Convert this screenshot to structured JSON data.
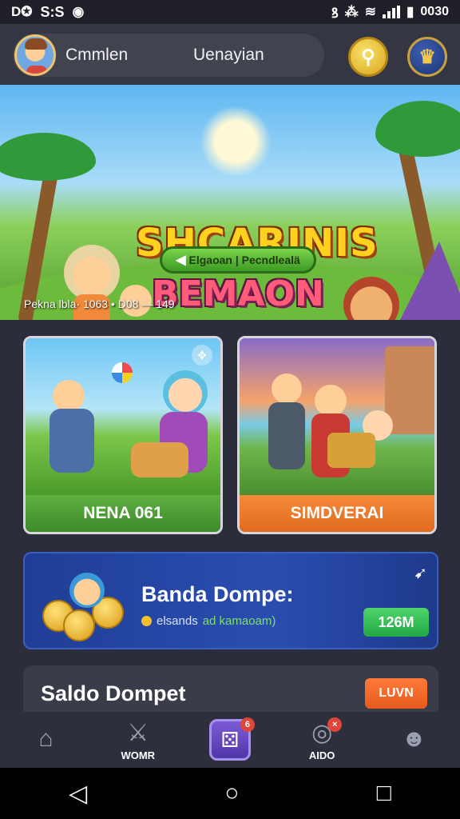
{
  "status_bar": {
    "left_text": "S:S",
    "time": "0030"
  },
  "header": {
    "profile_name": "Cmmlen",
    "profile_sub": "Uenayian"
  },
  "banner": {
    "title_line1": "SHCARINIS",
    "title_line2": "BEMAON",
    "cta_label": "Elgaoan | Pecndlealä",
    "caption": "Pekna lbla· 1063 • D08 — 149"
  },
  "games": [
    {
      "label": "NENA 061"
    },
    {
      "label": "SIMDVERAI"
    }
  ],
  "wallet": {
    "title": "Banda Dompe:",
    "sub_text": "elsands",
    "sub_highlight": "ad kamaoam)",
    "button_label": "126M"
  },
  "saldo": {
    "title": "Saldo Dompet",
    "button_label": "LUVN"
  },
  "bottom_nav": [
    {
      "label": "",
      "icon": "home-icon"
    },
    {
      "label": "WOMR",
      "icon": "sword-icon"
    },
    {
      "label": "",
      "icon": "dice-icon",
      "badge": "6"
    },
    {
      "label": "AIDO",
      "icon": "target-icon",
      "badge": "×"
    },
    {
      "label": "",
      "icon": "profile-icon"
    }
  ],
  "colors": {
    "background": "#2b2d3a",
    "accent_green": "#4fd36b",
    "accent_orange": "#f6893a",
    "wallet_blue": "#2a4db0"
  }
}
